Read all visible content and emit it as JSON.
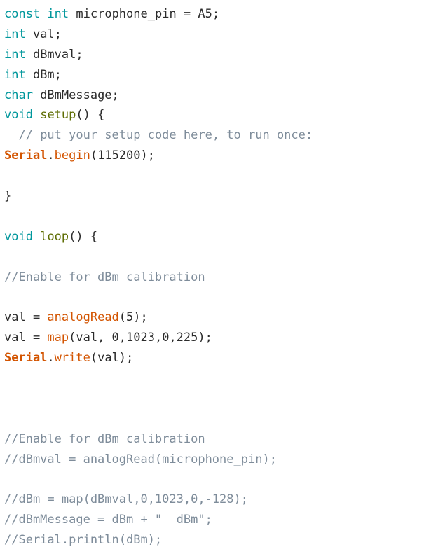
{
  "document": {
    "type": "source-code-listing",
    "language": "arduino-c",
    "background_color": "#ffffff",
    "theme": "arduino-ide-light"
  },
  "colors": {
    "keyword": "#00979c",
    "function_definition": "#5e6d03",
    "builtin_function": "#d35400",
    "object": "#d35400",
    "comment": "#7e8c9a",
    "plain_text": "#2b2b2b",
    "background": "#ffffff"
  },
  "code": {
    "lines": [
      {
        "index": 1,
        "text": "const int microphone_pin = A5;",
        "tokens": [
          {
            "t": "const",
            "c": "keyword"
          },
          {
            "t": " ",
            "c": "plain"
          },
          {
            "t": "int",
            "c": "keyword"
          },
          {
            "t": " microphone_pin = A5;",
            "c": "plain"
          }
        ]
      },
      {
        "index": 2,
        "text": "int val;",
        "tokens": [
          {
            "t": "int",
            "c": "keyword"
          },
          {
            "t": " val;",
            "c": "plain"
          }
        ]
      },
      {
        "index": 3,
        "text": "int dBmval;",
        "tokens": [
          {
            "t": "int",
            "c": "keyword"
          },
          {
            "t": " dBmval;",
            "c": "plain"
          }
        ]
      },
      {
        "index": 4,
        "text": "int dBm;",
        "tokens": [
          {
            "t": "int",
            "c": "keyword"
          },
          {
            "t": " dBm;",
            "c": "plain"
          }
        ]
      },
      {
        "index": 5,
        "text": "char dBmMessage;",
        "tokens": [
          {
            "t": "char",
            "c": "keyword"
          },
          {
            "t": " dBmMessage;",
            "c": "plain"
          }
        ]
      },
      {
        "index": 6,
        "text": "void setup() {",
        "tokens": [
          {
            "t": "void",
            "c": "keyword"
          },
          {
            "t": " ",
            "c": "plain"
          },
          {
            "t": "setup",
            "c": "function_definition"
          },
          {
            "t": "() {",
            "c": "plain"
          }
        ]
      },
      {
        "index": 7,
        "text": "  // put your setup code here, to run once:",
        "tokens": [
          {
            "t": "  ",
            "c": "plain"
          },
          {
            "t": "// put your setup code here, to run once:",
            "c": "comment"
          }
        ]
      },
      {
        "index": 8,
        "text": "Serial.begin(115200);",
        "tokens": [
          {
            "t": "Serial",
            "c": "object"
          },
          {
            "t": ".",
            "c": "plain"
          },
          {
            "t": "begin",
            "c": "builtin_function"
          },
          {
            "t": "(115200);",
            "c": "plain"
          }
        ]
      },
      {
        "index": 9,
        "text": "",
        "tokens": []
      },
      {
        "index": 10,
        "text": "}",
        "tokens": [
          {
            "t": "}",
            "c": "plain"
          }
        ]
      },
      {
        "index": 11,
        "text": "",
        "tokens": []
      },
      {
        "index": 12,
        "text": "void loop() {",
        "tokens": [
          {
            "t": "void",
            "c": "keyword"
          },
          {
            "t": " ",
            "c": "plain"
          },
          {
            "t": "loop",
            "c": "function_definition"
          },
          {
            "t": "() {",
            "c": "plain"
          }
        ]
      },
      {
        "index": 13,
        "text": "",
        "tokens": []
      },
      {
        "index": 14,
        "text": "//Enable for dBm calibration",
        "tokens": [
          {
            "t": "//Enable for dBm calibration",
            "c": "comment"
          }
        ]
      },
      {
        "index": 15,
        "text": "",
        "tokens": []
      },
      {
        "index": 16,
        "text": "val = analogRead(5);",
        "tokens": [
          {
            "t": "val = ",
            "c": "plain"
          },
          {
            "t": "analogRead",
            "c": "builtin_function"
          },
          {
            "t": "(5);",
            "c": "plain"
          }
        ]
      },
      {
        "index": 17,
        "text": "val = map(val, 0,1023,0,225);",
        "tokens": [
          {
            "t": "val = ",
            "c": "plain"
          },
          {
            "t": "map",
            "c": "builtin_function"
          },
          {
            "t": "(val, 0,1023,0,225);",
            "c": "plain"
          }
        ]
      },
      {
        "index": 18,
        "text": "Serial.write(val);",
        "tokens": [
          {
            "t": "Serial",
            "c": "object"
          },
          {
            "t": ".",
            "c": "plain"
          },
          {
            "t": "write",
            "c": "builtin_function"
          },
          {
            "t": "(val);",
            "c": "plain"
          }
        ]
      },
      {
        "index": 19,
        "text": "",
        "tokens": []
      },
      {
        "index": 20,
        "text": "",
        "tokens": []
      },
      {
        "index": 21,
        "text": "",
        "tokens": []
      },
      {
        "index": 22,
        "text": "//Enable for dBm calibration",
        "tokens": [
          {
            "t": "//Enable for dBm calibration",
            "c": "comment"
          }
        ]
      },
      {
        "index": 23,
        "text": "//dBmval = analogRead(microphone_pin);",
        "tokens": [
          {
            "t": "//dBmval = analogRead(microphone_pin);",
            "c": "comment"
          }
        ]
      },
      {
        "index": 24,
        "text": "",
        "tokens": []
      },
      {
        "index": 25,
        "text": "//dBm = map(dBmval,0,1023,0,-128);",
        "tokens": [
          {
            "t": "//dBm = map(dBmval,0,1023,0,-128);",
            "c": "comment"
          }
        ]
      },
      {
        "index": 26,
        "text": "//dBmMessage = dBm + \"  dBm\";",
        "tokens": [
          {
            "t": "//dBmMessage = dBm + \"  dBm\";",
            "c": "comment"
          }
        ]
      },
      {
        "index": 27,
        "text": "//Serial.println(dBm);",
        "tokens": [
          {
            "t": "//Serial.println(dBm);",
            "c": "comment"
          }
        ]
      }
    ]
  }
}
